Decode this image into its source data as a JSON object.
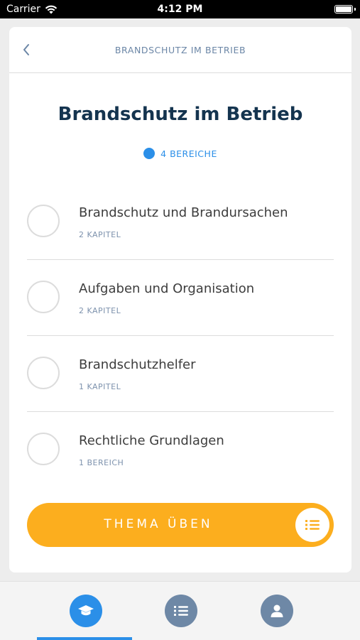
{
  "status_bar": {
    "carrier": "Carrier",
    "time": "4:12 PM"
  },
  "nav": {
    "title": "BRANDSCHUTZ IM BETRIEB"
  },
  "page": {
    "title": "Brandschutz im Betrieb",
    "section_count": "4 BEREICHE"
  },
  "items": [
    {
      "title": "Brandschutz und Brandursachen",
      "subtitle": "2 KAPITEL"
    },
    {
      "title": "Aufgaben und Organisation",
      "subtitle": "2 KAPITEL"
    },
    {
      "title": "Brandschutzhelfer",
      "subtitle": "1 KAPITEL"
    },
    {
      "title": "Rechtliche Grundlagen",
      "subtitle": "1 BEREICH"
    }
  ],
  "cta": {
    "label": "THEMA ÜBEN"
  },
  "tabs": [
    {
      "icon": "graduation-cap-icon",
      "active": true
    },
    {
      "icon": "list-icon",
      "active": false
    },
    {
      "icon": "profile-icon",
      "active": false
    }
  ],
  "colors": {
    "accent_blue": "#2b8fe8",
    "title_navy": "#14344f",
    "cta_orange": "#fcae1e",
    "muted_blue": "#6e88a6"
  }
}
